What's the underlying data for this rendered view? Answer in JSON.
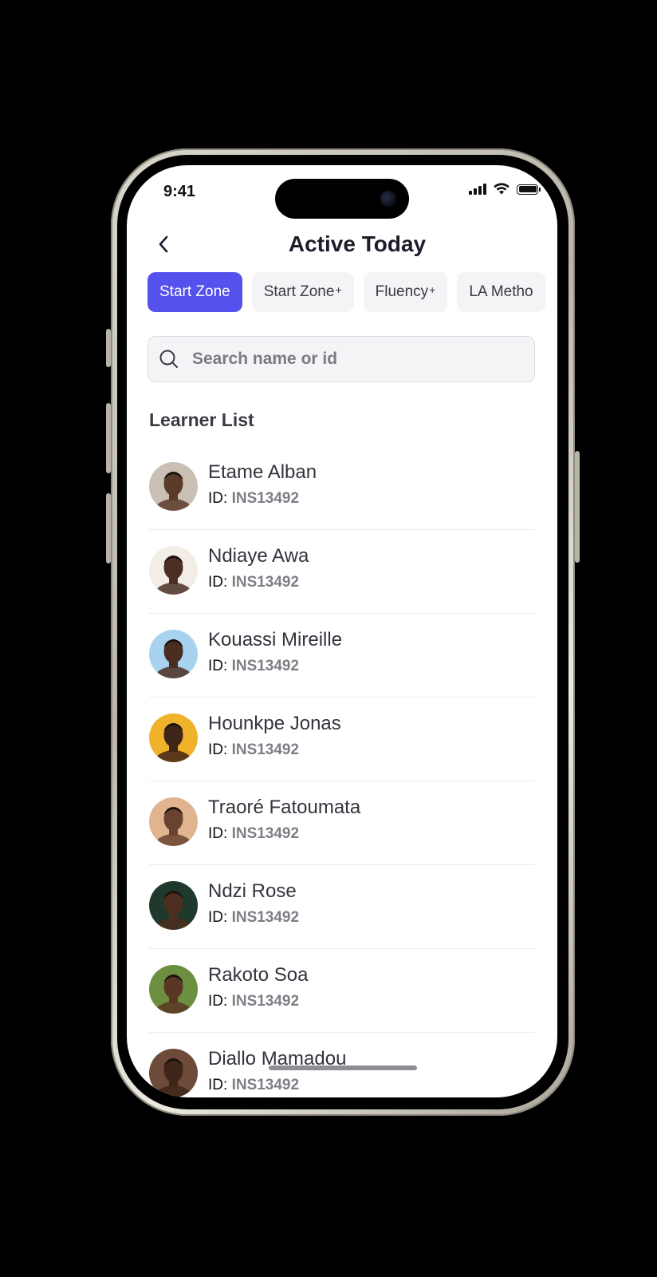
{
  "status_bar": {
    "time": "9:41"
  },
  "header": {
    "title": "Active Today"
  },
  "chips": [
    {
      "label": "Start Zone",
      "suffix": "",
      "active": true
    },
    {
      "label": "Start Zone",
      "suffix": "+",
      "active": false
    },
    {
      "label": "Fluency",
      "suffix": "+",
      "active": false
    },
    {
      "label": "LA Metho",
      "suffix": "",
      "active": false
    }
  ],
  "search": {
    "placeholder": "Search name or id",
    "value": ""
  },
  "section": {
    "title": "Learner List"
  },
  "id_prefix": "ID:",
  "learners": [
    {
      "name": "Etame Alban",
      "id": "INS13492",
      "avatar_bg": "#c9bfb3",
      "skin": "#5a3a28"
    },
    {
      "name": "Ndiaye Awa",
      "id": "INS13492",
      "avatar_bg": "#f2ede6",
      "skin": "#4a2f22"
    },
    {
      "name": "Kouassi Mireille",
      "id": "INS13492",
      "avatar_bg": "#a7d3ee",
      "skin": "#4b2d20"
    },
    {
      "name": "Hounkpe Jonas",
      "id": "INS13492",
      "avatar_bg": "#f0b22a",
      "skin": "#3f2418"
    },
    {
      "name": "Traoré Fatoumata",
      "id": "INS13492",
      "avatar_bg": "#e0b48e",
      "skin": "#6a4330"
    },
    {
      "name": "Ndzi Rose",
      "id": "INS13492",
      "avatar_bg": "#1f3a2c",
      "skin": "#4d2e20"
    },
    {
      "name": "Rakoto Soa",
      "id": "INS13492",
      "avatar_bg": "#6b8f3e",
      "skin": "#5a3725"
    },
    {
      "name": "Diallo Mamadou",
      "id": "INS13492",
      "avatar_bg": "#6e4a3a",
      "skin": "#3f2619"
    }
  ],
  "colors": {
    "accent": "#5551ec",
    "chip_bg": "#f4f4f6",
    "title": "#1d1d2b"
  },
  "icons": {
    "back": "chevron-left-icon",
    "search": "search-icon",
    "signal": "cellular-signal-icon",
    "wifi": "wifi-icon",
    "battery": "battery-icon"
  }
}
